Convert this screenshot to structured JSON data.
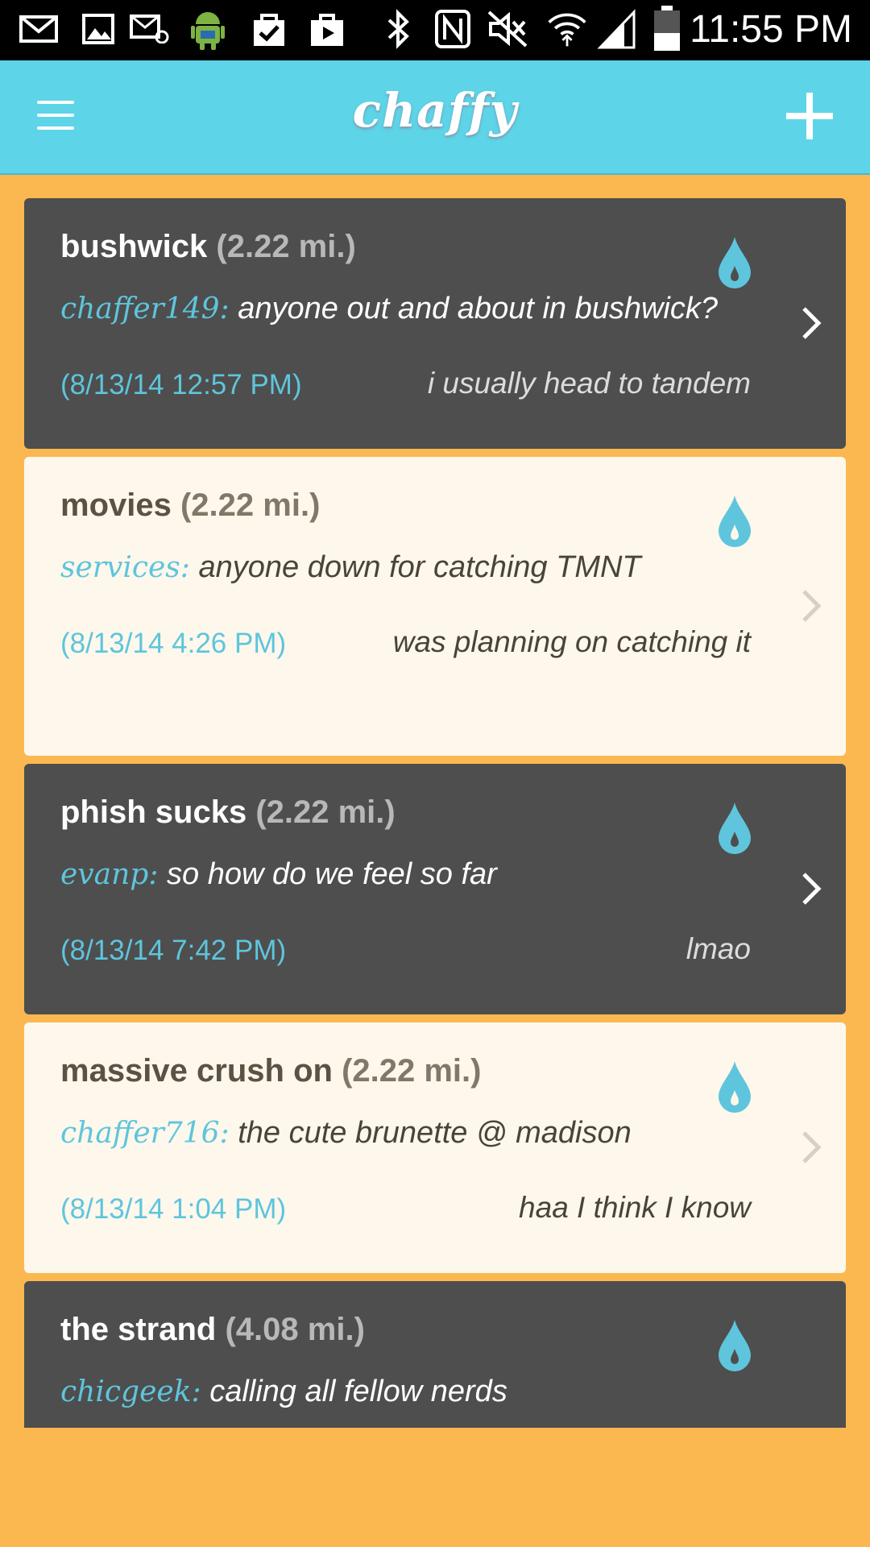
{
  "status_bar": {
    "time": "11:55 PM",
    "icons": [
      "mail-icon",
      "image-icon",
      "email-icon",
      "android-icon",
      "shopping-bag-check-icon",
      "play-store-icon",
      "bluetooth-icon",
      "nfc-icon",
      "mute-icon",
      "wifi-icon",
      "signal-icon",
      "battery-icon"
    ]
  },
  "app_bar": {
    "logo": "chaffy",
    "menu_icon": "hamburger-menu-icon",
    "add_icon": "plus-icon"
  },
  "colors": {
    "background": "#fbb851",
    "app_bar": "#5dd4e8",
    "accent": "#5ec5dc",
    "dark_card": "#4e4e4e",
    "light_card": "#fdf7ec"
  },
  "feed": [
    {
      "topic": "bushwick",
      "distance": "(2.22 mi.)",
      "user": "chaffer149:",
      "message": "anyone out and about in bushwick?",
      "timestamp": "(8/13/14 12:57 PM)",
      "reply": "i usually head to tandem",
      "theme": "dark"
    },
    {
      "topic": "movies",
      "distance": "(2.22 mi.)",
      "user": "services:",
      "message": "anyone down for catching TMNT",
      "timestamp": "(8/13/14 4:26 PM)",
      "reply": "was planning on catching it",
      "theme": "light"
    },
    {
      "topic": "phish sucks",
      "distance": "(2.22 mi.)",
      "user": "evanp:",
      "message": "so how do we feel so far",
      "timestamp": "(8/13/14 7:42 PM)",
      "reply": "lmao",
      "theme": "dark"
    },
    {
      "topic": "massive crush on",
      "distance": "(2.22 mi.)",
      "user": "chaffer716:",
      "message": "the cute brunette @ madison",
      "timestamp": "(8/13/14 1:04 PM)",
      "reply": "haa I think I know",
      "theme": "light"
    },
    {
      "topic": "the strand",
      "distance": "(4.08 mi.)",
      "user": "chicgeek:",
      "message": "calling all fellow nerds",
      "timestamp": "",
      "reply": "",
      "theme": "dark"
    }
  ]
}
